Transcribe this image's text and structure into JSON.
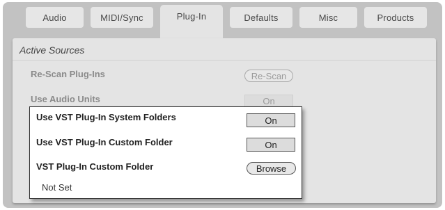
{
  "tabs": [
    {
      "label": "Audio"
    },
    {
      "label": "MIDI/Sync"
    },
    {
      "label": "Plug-In"
    },
    {
      "label": "Defaults"
    },
    {
      "label": "Misc"
    },
    {
      "label": "Products"
    }
  ],
  "active_tab": "Plug-In",
  "section": {
    "title": "Active Sources"
  },
  "rows": {
    "rescan": {
      "label": "Re-Scan Plug-Ins",
      "button": "Re-Scan"
    },
    "audio_units": {
      "label": "Use Audio Units",
      "value": "On"
    },
    "vst_system": {
      "label": "Use VST Plug-In System Folders",
      "value": "On"
    },
    "vst_custom": {
      "label": "Use VST Plug-In Custom Folder",
      "value": "On"
    },
    "vst_folder": {
      "label": "VST Plug-In Custom Folder",
      "button": "Browse",
      "path": "Not Set"
    }
  }
}
